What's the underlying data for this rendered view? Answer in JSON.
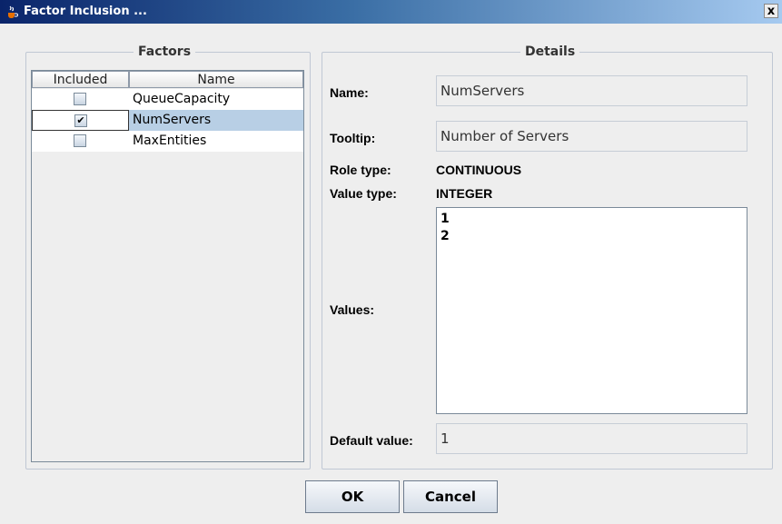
{
  "window": {
    "title": "Factor Inclusion ...",
    "close_glyph": "x",
    "icon": "java-cup-icon"
  },
  "factors": {
    "title": "Factors",
    "columns": [
      "Included",
      "Name"
    ],
    "rows": [
      {
        "included": false,
        "check": "",
        "name": "QueueCapacity"
      },
      {
        "included": true,
        "check": "✔",
        "name": "NumServers"
      },
      {
        "included": false,
        "check": "",
        "name": "MaxEntities"
      }
    ]
  },
  "details": {
    "title": "Details",
    "name_label": "Name:",
    "name_value": "NumServers",
    "tooltip_label": "Tooltip:",
    "tooltip_value": "Number of Servers",
    "role_label": "Role type:",
    "role_value": "CONTINUOUS",
    "valuetype_label": "Value type:",
    "valuetype_value": "INTEGER",
    "values_label": "Values:",
    "values": [
      "1",
      "2"
    ],
    "default_label": "Default value:",
    "default_value": "1"
  },
  "buttons": {
    "ok": "OK",
    "cancel": "Cancel"
  }
}
